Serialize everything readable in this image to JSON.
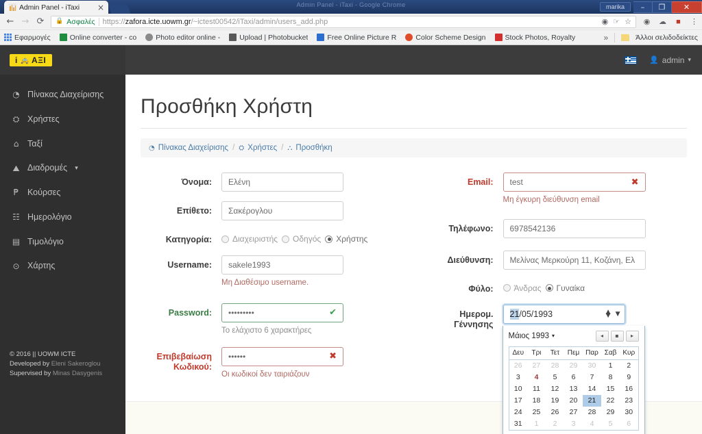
{
  "browser": {
    "window_title": "Admin Panel - iTaxi - Google Chrome",
    "window_user": "marika",
    "tab": {
      "title": "Admin Panel - iTaxi",
      "close_label": "×",
      "favicon_name": "pma-favicon"
    },
    "controls": {
      "minimize": "–",
      "maximize": "❐",
      "close": "✕"
    },
    "nav": {
      "back": "←",
      "forward": "→",
      "reload": "⟳"
    },
    "omnibox": {
      "lock_icon": "🔒",
      "secure_label": "Ασφαλές",
      "url_scheme": "https://",
      "url_host": "zafora.icte.uowm.gr",
      "url_path": "/~ictest00542/iTaxi/admin/users_add.php",
      "icons": [
        "record-icon",
        "pin-icon",
        "star-icon"
      ]
    },
    "toolbar_icons": [
      "extension-globe-icon",
      "cloud-icon",
      "pdf-icon",
      "menu-kebab-icon"
    ],
    "bookmarks": [
      {
        "label": "Εφαρμογές",
        "icon": "apps-grid-icon",
        "color": "#4a86e8"
      },
      {
        "label": "Online converter - co",
        "icon": "converter-icon",
        "color": "#1e8e3e"
      },
      {
        "label": "Photo editor online -",
        "icon": "photo-editor-icon",
        "color": "#8a8a8a"
      },
      {
        "label": "Upload | Photobucket",
        "icon": "photobucket-icon",
        "color": "#5a5a5a"
      },
      {
        "label": "Free Online Picture R",
        "icon": "picture-resize-icon",
        "color": "#2d6fd1"
      },
      {
        "label": "Color Scheme Design",
        "icon": "color-wheel-icon",
        "color": "#e04b2a"
      },
      {
        "label": "Stock Photos, Royalty",
        "icon": "stock-photos-icon",
        "color": "#d32f2f"
      }
    ],
    "bookmarks_overflow": "»",
    "other_bookmarks": "Άλλοι σελιδοδείκτες"
  },
  "navbar": {
    "brand": "iTΑΞΙ",
    "brand_icon": "taxi-icon",
    "language_icon": "greek-flag-icon",
    "user": "admin",
    "user_icon": "user-icon",
    "user_caret": "▾"
  },
  "sidebar": {
    "items": [
      {
        "label": "Πίνακας Διαχείρισης",
        "icon": "dashboard-icon",
        "glyph": "◔",
        "caret": ""
      },
      {
        "label": "Χρήστες",
        "icon": "users-icon",
        "glyph": "⛭",
        "caret": ""
      },
      {
        "label": "Ταξί",
        "icon": "car-icon",
        "glyph": "⌂",
        "caret": ""
      },
      {
        "label": "Διαδρομές",
        "icon": "routes-icon",
        "glyph": "⛰",
        "caret": "▾"
      },
      {
        "label": "Κούρσες",
        "icon": "currency-icon",
        "glyph": "₱",
        "caret": ""
      },
      {
        "label": "Ημερολόγιο",
        "icon": "calendar-icon",
        "glyph": "☷",
        "caret": ""
      },
      {
        "label": "Τιμολόγιο",
        "icon": "invoice-icon",
        "glyph": "▤",
        "caret": ""
      },
      {
        "label": "Χάρτης",
        "icon": "map-pin-icon",
        "glyph": "⊙",
        "caret": ""
      }
    ],
    "footer": {
      "line1": "© 2016 || UOWM ICTE",
      "line2_prefix": "Developed by",
      "line2_name": "Eleni Sakeroglou",
      "line3_prefix": "Supervised by",
      "line3_name": "Minas Dasygenis"
    }
  },
  "main": {
    "title": "Προσθήκη Χρήστη",
    "breadcrumb": [
      {
        "label": "Πίνακας Διαχείρισης",
        "icon": "dashboard-icon",
        "glyph": "◔"
      },
      {
        "label": "Χρήστες",
        "icon": "users-icon",
        "glyph": "⛭"
      },
      {
        "label": "Προσθήκη",
        "icon": "add-user-icon",
        "glyph": "⛬"
      }
    ],
    "separator": "/"
  },
  "form": {
    "firstname": {
      "label": "Όνομα:",
      "value": "Ελένη"
    },
    "lastname": {
      "label": "Επίθετο:",
      "value": "Σακέρογλου"
    },
    "category": {
      "label": "Κατηγορία:",
      "options": [
        {
          "label": "Διαχειριστής",
          "selected": false
        },
        {
          "label": "Οδηγός",
          "selected": false
        },
        {
          "label": "Χρήστης",
          "selected": true
        }
      ]
    },
    "username": {
      "label": "Username:",
      "value": "sakele1993",
      "hint": "Μη Διαθέσιμο username."
    },
    "password": {
      "label": "Password:",
      "value": "•••••••••",
      "hint": "Το ελάχιστο 6 χαρακτήρες",
      "mark": "✔"
    },
    "password_confirm": {
      "label_l1": "Επιβεβαίωση",
      "label_l2": "Κωδικού:",
      "value": "••••••",
      "hint": "Οι κωδικοί δεν ταιριάζουν",
      "mark": "✖"
    },
    "email": {
      "label": "Email:",
      "value": "test",
      "hint": "Μη έγκυρη διεύθυνση email",
      "mark": "✖"
    },
    "phone": {
      "label": "Τηλέφωνο:",
      "value": "6978542136"
    },
    "address": {
      "label": "Διεύθυνση:",
      "value": "Μελίνας Μερκούρη 11, Κοζάνη, Ελ"
    },
    "gender": {
      "label": "Φύλο:",
      "options": [
        {
          "label": "Άνδρας",
          "selected": false
        },
        {
          "label": "Γυναίκα",
          "selected": true
        }
      ]
    },
    "birthdate": {
      "label_l1": "Ημερομ.",
      "label_l2": "Γέννησης",
      "day": "21",
      "rest": "/05/1993",
      "spin_up": "▲",
      "spin_down": "▼",
      "dropdown_caret": "▼"
    }
  },
  "datepicker": {
    "month_label": "Μάιος 1993",
    "month_caret": "▾",
    "nav": {
      "prev": "◂",
      "today": "▪",
      "next": "▸"
    },
    "weekdays": [
      "Δευ",
      "Τρι",
      "Τετ",
      "Πεμ",
      "Παρ",
      "Σαβ",
      "Κυρ"
    ],
    "weeks": [
      [
        {
          "d": "26",
          "type": "mute"
        },
        {
          "d": "27",
          "type": "mute"
        },
        {
          "d": "28",
          "type": "mute"
        },
        {
          "d": "29",
          "type": "mute"
        },
        {
          "d": "30",
          "type": "mute"
        },
        {
          "d": "1",
          "type": ""
        },
        {
          "d": "2",
          "type": ""
        }
      ],
      [
        {
          "d": "3",
          "type": ""
        },
        {
          "d": "4",
          "type": "today"
        },
        {
          "d": "5",
          "type": ""
        },
        {
          "d": "6",
          "type": ""
        },
        {
          "d": "7",
          "type": ""
        },
        {
          "d": "8",
          "type": ""
        },
        {
          "d": "9",
          "type": ""
        }
      ],
      [
        {
          "d": "10",
          "type": ""
        },
        {
          "d": "11",
          "type": ""
        },
        {
          "d": "12",
          "type": ""
        },
        {
          "d": "13",
          "type": ""
        },
        {
          "d": "14",
          "type": ""
        },
        {
          "d": "15",
          "type": ""
        },
        {
          "d": "16",
          "type": ""
        }
      ],
      [
        {
          "d": "17",
          "type": ""
        },
        {
          "d": "18",
          "type": ""
        },
        {
          "d": "19",
          "type": ""
        },
        {
          "d": "20",
          "type": ""
        },
        {
          "d": "21",
          "type": "sel"
        },
        {
          "d": "22",
          "type": ""
        },
        {
          "d": "23",
          "type": ""
        }
      ],
      [
        {
          "d": "24",
          "type": ""
        },
        {
          "d": "25",
          "type": ""
        },
        {
          "d": "26",
          "type": ""
        },
        {
          "d": "27",
          "type": ""
        },
        {
          "d": "28",
          "type": ""
        },
        {
          "d": "29",
          "type": ""
        },
        {
          "d": "30",
          "type": ""
        }
      ],
      [
        {
          "d": "31",
          "type": ""
        },
        {
          "d": "1",
          "type": "mute"
        },
        {
          "d": "2",
          "type": "mute"
        },
        {
          "d": "3",
          "type": "mute"
        },
        {
          "d": "4",
          "type": "mute"
        },
        {
          "d": "5",
          "type": "mute"
        },
        {
          "d": "6",
          "type": "mute"
        }
      ]
    ]
  },
  "colors": {
    "brand_yellow": "#f7d917",
    "sidebar_bg": "#2f2f2f",
    "navbar_bg": "#3c3c3c",
    "error_red": "#c0392b",
    "success_green": "#3a9d4a",
    "link_blue": "#4a7ba7",
    "select_blue": "#aecbe8"
  }
}
